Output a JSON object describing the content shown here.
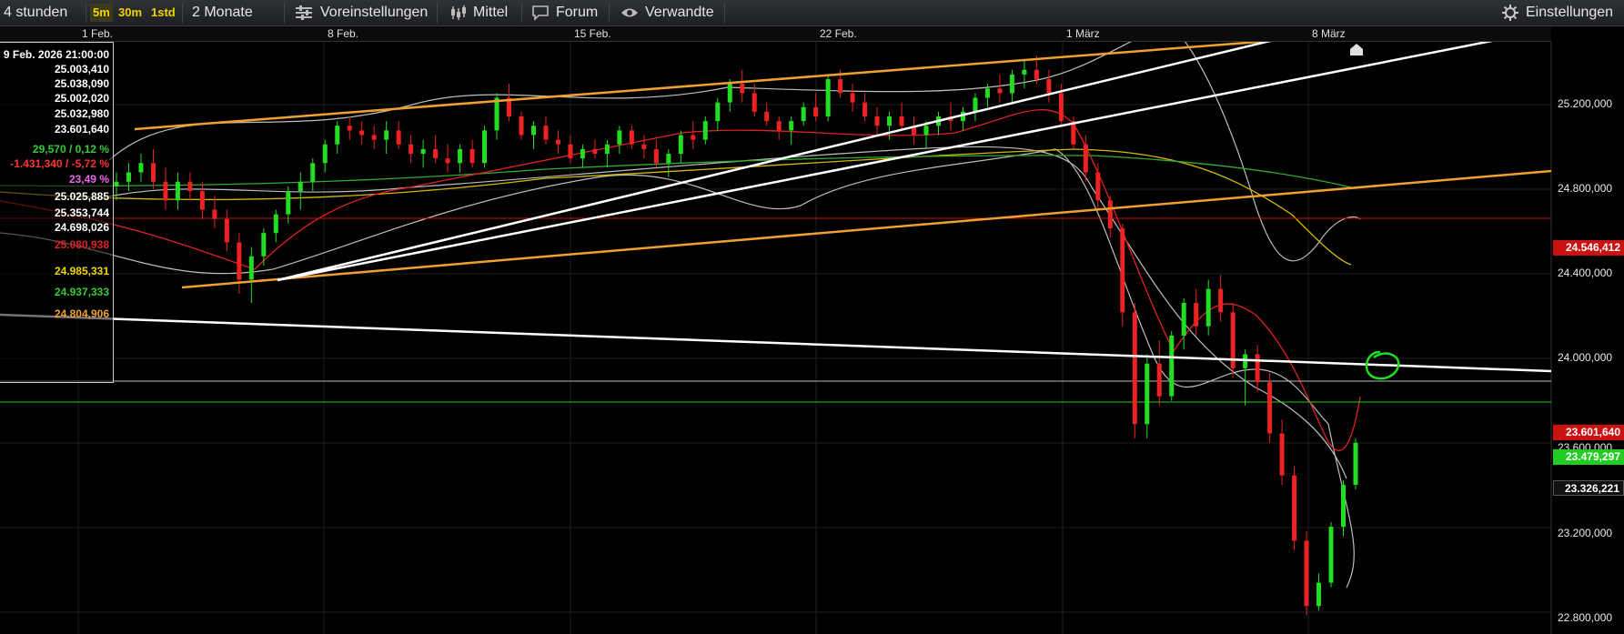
{
  "toolbar": {
    "timeframe": "4 stunden",
    "intervals": [
      "5m",
      "30m",
      "1std"
    ],
    "range": "2 Monate",
    "presets": "Voreinstellungen",
    "indicator": "Mittel",
    "forum": "Forum",
    "related": "Verwandte",
    "settings": "Einstellungen"
  },
  "x_labels": [
    "1 Feb.",
    "8 Feb.",
    "15 Feb.",
    "22 Feb.",
    "1 März",
    "8 März"
  ],
  "y_labels": [
    "25.200,000",
    "24.800,000",
    "24.400,000",
    "24.000,000",
    "23.200,000",
    "22.800,000"
  ],
  "badges": {
    "red_level": "24.546,412",
    "last_price": "23.601,640",
    "green_level": "23.479,297",
    "white_level": "23.326,221",
    "hidden_label": "23.600,000"
  },
  "infobox": {
    "date": "9 Feb. 2026 21:00:00",
    "values": [
      {
        "text": "25.003,410",
        "color": "#ffffff"
      },
      {
        "text": "25.038,090",
        "color": "#ffffff"
      },
      {
        "text": "25.002,020",
        "color": "#ffffff"
      },
      {
        "text": "25.032,980",
        "color": "#ffffff"
      },
      {
        "text": "23.601,640",
        "color": "#ffffff"
      },
      {
        "text": "29,570 / 0,12 %",
        "color": "#33cc33"
      },
      {
        "text": "-1.431,340 / -5,72 %",
        "color": "#ff3333"
      },
      {
        "text": "23,49 %",
        "color": "#ee66ee"
      },
      {
        "text": "25.025,885",
        "color": "#ffffff"
      },
      {
        "text": "25.353,744",
        "color": "#ffffff"
      },
      {
        "text": "24.698,026",
        "color": "#ffffff"
      },
      {
        "text": "25.080,938",
        "color": "#dd2222"
      },
      {
        "text": "24.985,331",
        "color": "#f0d400"
      },
      {
        "text": "24.937,333",
        "color": "#33cc33"
      },
      {
        "text": "24.804,906",
        "color": "#f0a030"
      }
    ]
  },
  "chart_data": {
    "type": "candlestick",
    "timeframe": "4 stunden",
    "x_ticks": [
      "1 Feb.",
      "8 Feb.",
      "15 Feb.",
      "22 Feb.",
      "1 März",
      "8 März"
    ],
    "y_ticks": [
      25200,
      24800,
      24400,
      24000,
      23600,
      23200,
      22800
    ],
    "ylim": [
      22780,
      25320
    ],
    "levels": {
      "red": 24546.412,
      "last": 23601.64,
      "green": 23479.297,
      "white": 23326.221
    },
    "colors": {
      "up": "#22dd22",
      "down": "#ee2222",
      "trend": "#ffffff",
      "channel": "#f0a030",
      "bollinger": "#cccccc",
      "sma_yellow": "#d4b800",
      "sma_green": "#33aa33",
      "sma_red": "#dd2222"
    },
    "candles": [
      [
        24700,
        24760,
        24640,
        24720
      ],
      [
        24720,
        24800,
        24680,
        24760
      ],
      [
        24760,
        24840,
        24720,
        24800
      ],
      [
        24800,
        24860,
        24690,
        24720
      ],
      [
        24720,
        24780,
        24600,
        24640
      ],
      [
        24640,
        24760,
        24600,
        24720
      ],
      [
        24720,
        24760,
        24640,
        24680
      ],
      [
        24680,
        24720,
        24560,
        24600
      ],
      [
        24600,
        24660,
        24520,
        24560
      ],
      [
        24560,
        24600,
        24420,
        24460
      ],
      [
        24460,
        24500,
        24240,
        24300
      ],
      [
        24300,
        24440,
        24200,
        24400
      ],
      [
        24400,
        24520,
        24360,
        24500
      ],
      [
        24500,
        24600,
        24460,
        24580
      ],
      [
        24580,
        24700,
        24540,
        24680
      ],
      [
        24680,
        24760,
        24600,
        24720
      ],
      [
        24720,
        24820,
        24680,
        24800
      ],
      [
        24800,
        24900,
        24760,
        24880
      ],
      [
        24880,
        24980,
        24840,
        24960
      ],
      [
        24960,
        25000,
        24900,
        24940
      ],
      [
        24940,
        24980,
        24880,
        24920
      ],
      [
        24920,
        24960,
        24860,
        24900
      ],
      [
        24900,
        24980,
        24840,
        24940
      ],
      [
        24940,
        24980,
        24860,
        24880
      ],
      [
        24880,
        24920,
        24800,
        24840
      ],
      [
        24840,
        24900,
        24780,
        24860
      ],
      [
        24860,
        24920,
        24800,
        24820
      ],
      [
        24820,
        24880,
        24760,
        24800
      ],
      [
        24800,
        24880,
        24760,
        24860
      ],
      [
        24860,
        24900,
        24780,
        24800
      ],
      [
        24800,
        24960,
        24780,
        24940
      ],
      [
        24940,
        25100,
        24900,
        25080
      ],
      [
        25080,
        25140,
        24980,
        25000
      ],
      [
        25000,
        25020,
        24900,
        24920
      ],
      [
        24920,
        24980,
        24860,
        24960
      ],
      [
        24960,
        25000,
        24880,
        24900
      ],
      [
        24900,
        24940,
        24840,
        24880
      ],
      [
        24880,
        24920,
        24800,
        24820
      ],
      [
        24820,
        24880,
        24780,
        24860
      ],
      [
        24860,
        24900,
        24820,
        24840
      ],
      [
        24840,
        24900,
        24780,
        24880
      ],
      [
        24880,
        24960,
        24840,
        24940
      ],
      [
        24940,
        24960,
        24860,
        24880
      ],
      [
        24880,
        24920,
        24820,
        24860
      ],
      [
        24860,
        24900,
        24780,
        24800
      ],
      [
        24800,
        24860,
        24740,
        24840
      ],
      [
        24840,
        24940,
        24800,
        24920
      ],
      [
        24920,
        24980,
        24860,
        24900
      ],
      [
        24900,
        25000,
        24880,
        24980
      ],
      [
        24980,
        25080,
        24940,
        25060
      ],
      [
        25060,
        25160,
        25020,
        25140
      ],
      [
        25140,
        25200,
        25060,
        25100
      ],
      [
        25100,
        25140,
        25000,
        25020
      ],
      [
        25020,
        25060,
        24960,
        24980
      ],
      [
        24980,
        25000,
        24900,
        24940
      ],
      [
        24940,
        25000,
        24880,
        24980
      ],
      [
        24980,
        25060,
        24960,
        25040
      ],
      [
        25040,
        25100,
        24980,
        25000
      ],
      [
        25000,
        25180,
        24980,
        25160
      ],
      [
        25160,
        25200,
        25080,
        25100
      ],
      [
        25100,
        25140,
        25020,
        25060
      ],
      [
        25060,
        25100,
        24980,
        25000
      ],
      [
        25000,
        25040,
        24920,
        24960
      ],
      [
        24960,
        25020,
        24900,
        25000
      ],
      [
        25000,
        25060,
        24940,
        24960
      ],
      [
        24960,
        25000,
        24880,
        24920
      ],
      [
        24920,
        24980,
        24860,
        24960
      ],
      [
        24960,
        25020,
        24920,
        25000
      ],
      [
        25000,
        25060,
        24940,
        24980
      ],
      [
        24980,
        25040,
        24940,
        25020
      ],
      [
        25020,
        25100,
        24980,
        25080
      ],
      [
        25080,
        25140,
        25040,
        25120
      ],
      [
        25120,
        25180,
        25060,
        25100
      ],
      [
        25100,
        25200,
        25060,
        25180
      ],
      [
        25180,
        25240,
        25120,
        25200
      ],
      [
        25200,
        25260,
        25140,
        25160
      ],
      [
        25160,
        25200,
        25060,
        25100
      ],
      [
        25100,
        25140,
        24960,
        24980
      ],
      [
        24980,
        25000,
        24860,
        24880
      ],
      [
        24880,
        24920,
        24720,
        24760
      ],
      [
        24760,
        24800,
        24600,
        24640
      ],
      [
        24640,
        24660,
        24480,
        24520
      ],
      [
        24520,
        24540,
        24100,
        24160
      ],
      [
        24160,
        24200,
        23620,
        23680
      ],
      [
        23680,
        23980,
        23620,
        23940
      ],
      [
        23940,
        24040,
        23760,
        23800
      ],
      [
        23800,
        24080,
        23780,
        24060
      ],
      [
        24060,
        24220,
        24000,
        24200
      ],
      [
        24200,
        24260,
        24060,
        24100
      ],
      [
        24100,
        24300,
        24060,
        24260
      ],
      [
        24260,
        24320,
        24120,
        24160
      ],
      [
        24160,
        24200,
        23880,
        23920
      ],
      [
        23920,
        24000,
        23760,
        23980
      ],
      [
        23980,
        24020,
        23820,
        23860
      ],
      [
        23860,
        23900,
        23600,
        23640
      ],
      [
        23640,
        23700,
        23420,
        23460
      ],
      [
        23460,
        23500,
        23140,
        23180
      ],
      [
        23180,
        23220,
        22860,
        22900
      ],
      [
        22900,
        23040,
        22880,
        23000
      ],
      [
        23000,
        23260,
        22980,
        23240
      ],
      [
        23240,
        23440,
        23200,
        23420
      ],
      [
        23420,
        23620,
        23400,
        23600
      ]
    ]
  }
}
